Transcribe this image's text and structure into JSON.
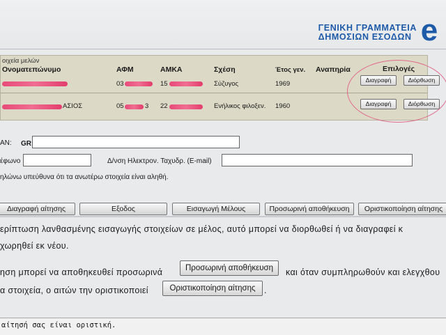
{
  "header": {
    "logo_line1": "ΓΕΝΙΚΗ ΓΡΑΜΜΑΤΕΙΑ",
    "logo_line2": "ΔΗΜΟΣΙΩΝ ΕΣΟΔΩΝ",
    "logo_mark": "e",
    "brand_color": "#1d5aa8"
  },
  "members": {
    "caption": "οιχεία μελών",
    "headers": {
      "name": "Ονοματεπώνυμο",
      "afm": "ΑΦΜ",
      "amka": "ΑΜΚΑ",
      "relation": "Σχέση",
      "year": "Έτος γεν.",
      "disability": "Αναπηρία",
      "options": "Επιλογές"
    },
    "rows": [
      {
        "name_suffix": "",
        "afm_prefix": "03",
        "amka_prefix": "15",
        "relation": "Σύζυγος",
        "year": "1969",
        "delete_label": "Διαγραφή",
        "edit_label": "Διόρθωση"
      },
      {
        "name_suffix": "ΑΣΙΟΣ",
        "afm_prefix": "05",
        "afm_suffix": "3",
        "amka_prefix": "22",
        "relation": "Ενήλικος φιλοξεν.",
        "year": "1960",
        "delete_label": "Διαγραφή",
        "edit_label": "Διόρθωση"
      }
    ],
    "redaction_color": "#e74a79",
    "highlight_color": "#e06a8a"
  },
  "form": {
    "iban_label": "AN:",
    "iban_prefix": "GR",
    "iban_value": "",
    "phone_label": "έφωνο",
    "phone_value": "",
    "email_label": "Δ/νση Ηλεκτρον. Ταχυδρ. (E-mail)",
    "email_value": "",
    "declaration": "ηλώνω υπεύθυνα ότι τα ανωτέρω στοιχεία είναι αληθή."
  },
  "actions": {
    "delete_application": "Διαγραφή αίτησης",
    "exit": "Εξοδος",
    "add_member": "Εισαγωγή Μέλους",
    "temp_save": "Προσωρινή αποθήκευση",
    "finalize": "Οριστικοποίηση αίτησης"
  },
  "help": {
    "line1": "ερίπτωση λανθασμένης εισαγωγής στοιχείων σε μέλος, αυτό μπορεί να διορθωθεί ή να διαγραφεί κ",
    "line2": "χωρηθεί εκ νέου.",
    "line3_a": "ηση μπορεί να αποθηκευθεί προσωρινά",
    "line3_button": "Προσωρινή αποθήκευση",
    "line3_b": "και όταν συμπληρωθούν και ελεγχθου",
    "line4_a": "α στοιχεία, ο αιτών την οριστικοποιεί",
    "line4_button": "Οριστικοποίηση αίτησης",
    "line4_b": "."
  },
  "status": {
    "text": "αίτησή σας είναι οριστική."
  }
}
